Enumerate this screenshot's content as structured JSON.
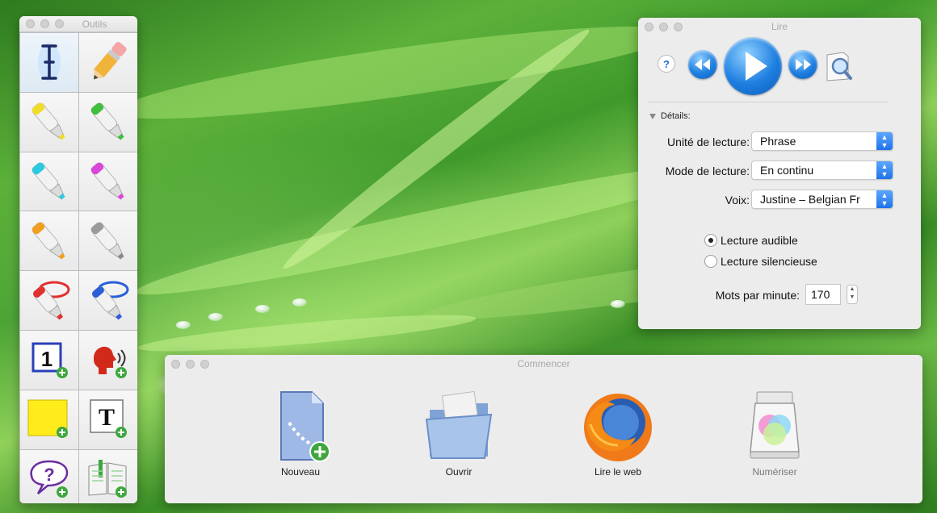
{
  "tools_window": {
    "title": "Outils",
    "tools": [
      {
        "name": "text-cursor-tool",
        "icon": "text-cursor-icon"
      },
      {
        "name": "eraser-tool",
        "icon": "eraser-icon"
      },
      {
        "name": "yellow-highlighter-tool",
        "icon": "highlighter-icon",
        "color": "#f2dc2a"
      },
      {
        "name": "green-highlighter-tool",
        "icon": "highlighter-icon",
        "color": "#3fbf3f"
      },
      {
        "name": "cyan-highlighter-tool",
        "icon": "highlighter-icon",
        "color": "#2cc9e0"
      },
      {
        "name": "magenta-highlighter-tool",
        "icon": "highlighter-icon",
        "color": "#d948d9"
      },
      {
        "name": "orange-highlighter-tool",
        "icon": "highlighter-icon",
        "color": "#f0a020"
      },
      {
        "name": "gray-highlighter-tool",
        "icon": "highlighter-icon",
        "color": "#9a9a9a"
      },
      {
        "name": "red-circle-highlighter-tool",
        "icon": "circle-highlighter-icon",
        "color": "#e23030"
      },
      {
        "name": "blue-circle-highlighter-tool",
        "icon": "circle-highlighter-icon",
        "color": "#2b5fd9"
      },
      {
        "name": "add-number-bookmark-tool",
        "icon": "number-box-icon",
        "text": "1"
      },
      {
        "name": "add-voice-note-tool",
        "icon": "speaking-head-icon"
      },
      {
        "name": "add-sticky-note-tool",
        "icon": "sticky-note-icon"
      },
      {
        "name": "add-text-box-tool",
        "icon": "text-box-icon",
        "text": "T"
      },
      {
        "name": "add-question-tool",
        "icon": "question-bubble-icon",
        "text": "?"
      },
      {
        "name": "add-bookmark-tool",
        "icon": "open-book-icon"
      }
    ]
  },
  "reader_window": {
    "title": "Lire",
    "help_label": "?",
    "details_label": "Détails:",
    "reading_unit": {
      "label": "Unité de lecture:",
      "value": "Phrase"
    },
    "reading_mode": {
      "label": "Mode de lecture:",
      "value": "En continu"
    },
    "voice": {
      "label": "Voix:",
      "value": "Justine – Belgian Fr"
    },
    "radio_audible": {
      "label": "Lecture audible",
      "checked": true
    },
    "radio_silent": {
      "label": "Lecture silencieuse",
      "checked": false
    },
    "words_per_minute": {
      "label": "Mots par minute:",
      "value": "170"
    }
  },
  "start_window": {
    "title": "Commencer",
    "items": [
      {
        "label": "Nouveau",
        "icon": "new-document-icon"
      },
      {
        "label": "Ouvrir",
        "icon": "open-folder-icon"
      },
      {
        "label": "Lire le web",
        "icon": "firefox-icon"
      },
      {
        "label": "Numériser",
        "icon": "scanner-icon",
        "dimmed": true
      }
    ]
  },
  "colors": {
    "accent": "#1f73e8",
    "play_button": "#1e7fe0"
  }
}
